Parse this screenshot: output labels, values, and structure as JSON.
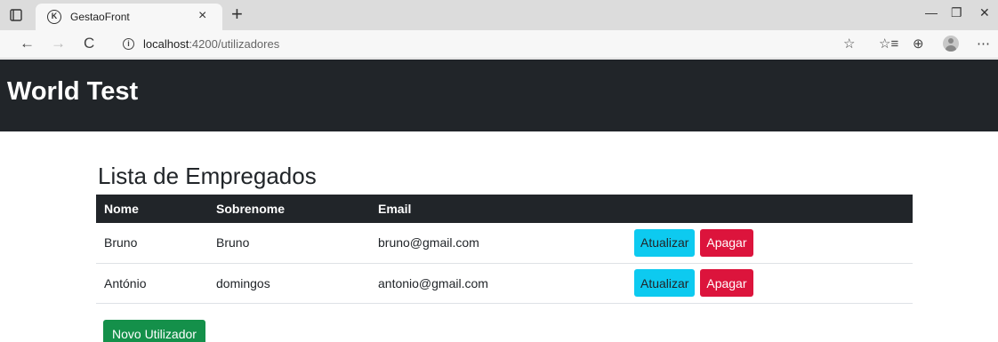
{
  "browser": {
    "tab_title": "GestaoFront",
    "tab_favicon": "K",
    "new_tab": "+",
    "close_tab": "×",
    "back": "←",
    "forward": "→",
    "reload": "C",
    "url_host": "localhost",
    "url_path": ":4200/utilizadores",
    "minimize": "—",
    "restore": "❐",
    "close_window": "✕",
    "add_favorite": "☆",
    "favorites": "☆≡",
    "collections": "⊕",
    "more": "⋯"
  },
  "app": {
    "title": "World Test"
  },
  "page": {
    "heading": "Lista de Empregados",
    "columns": [
      "Nome",
      "Sobrenome",
      "Email"
    ],
    "rows": [
      {
        "nome": "Bruno",
        "sobrenome": "Bruno",
        "email": "bruno@gmail.com"
      },
      {
        "nome": "António",
        "sobrenome": "domingos",
        "email": "antonio@gmail.com"
      }
    ],
    "update_label": "Atualizar",
    "delete_label": "Apagar",
    "new_user_label": "Novo Utilizador"
  },
  "colors": {
    "header_bg": "#212529",
    "info": "#0dcaf0",
    "danger": "#dc143c",
    "success": "#14904a"
  }
}
